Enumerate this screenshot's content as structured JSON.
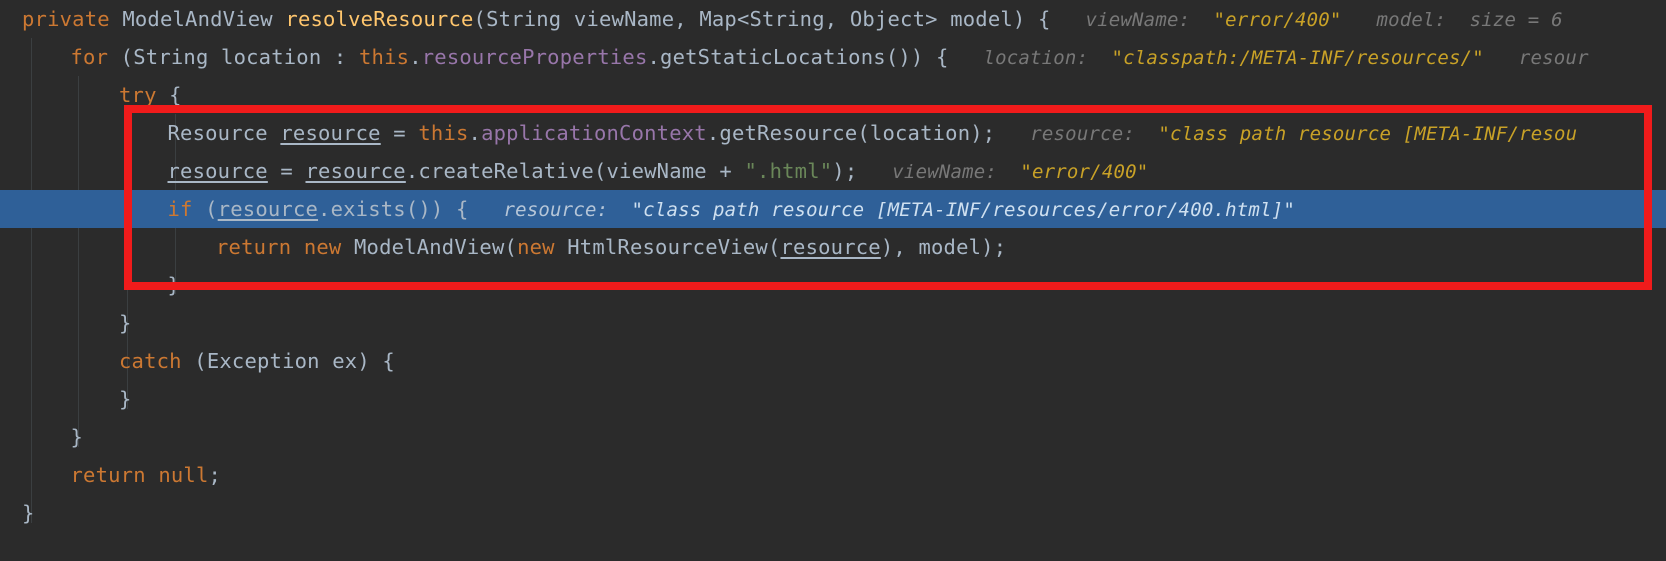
{
  "editor": {
    "language": "Java",
    "theme": "Darcula",
    "background_color": "#2b2b2b",
    "selected_line_color": "#2f6098",
    "annotation_color": "#f01b1b",
    "selected_line_number": 6
  },
  "annotation": {
    "shape": "rectangle",
    "color": "#f01b1b",
    "covers_lines": "Resource resource = ... through closing brace after return"
  },
  "lines": [
    {
      "id": "line-1",
      "indent": 0,
      "tokens": [
        {
          "t": "private",
          "c": "kw"
        },
        {
          "t": " ",
          "c": "plain"
        },
        {
          "t": "ModelAndView",
          "c": "type"
        },
        {
          "t": " ",
          "c": "plain"
        },
        {
          "t": "resolveResource",
          "c": "declfn"
        },
        {
          "t": "(",
          "c": "punct"
        },
        {
          "t": "String",
          "c": "type"
        },
        {
          "t": " viewName, ",
          "c": "plain"
        },
        {
          "t": "Map",
          "c": "type"
        },
        {
          "t": "<",
          "c": "punct"
        },
        {
          "t": "String",
          "c": "type"
        },
        {
          "t": ", ",
          "c": "plain"
        },
        {
          "t": "Object",
          "c": "type"
        },
        {
          "t": "> model) {",
          "c": "plain"
        }
      ],
      "hints": [
        {
          "name": "viewName:",
          "value": "\"error/400\"",
          "kind": "string"
        },
        {
          "name": "model:",
          "value": "size = 6",
          "kind": "plain"
        }
      ]
    },
    {
      "id": "line-2",
      "indent": 1,
      "tokens": [
        {
          "t": "for",
          "c": "kw"
        },
        {
          "t": " (",
          "c": "punct"
        },
        {
          "t": "String",
          "c": "type"
        },
        {
          "t": " location : ",
          "c": "plain"
        },
        {
          "t": "this",
          "c": "kw"
        },
        {
          "t": ".",
          "c": "punct"
        },
        {
          "t": "resourceProperties",
          "c": "field"
        },
        {
          "t": ".",
          "c": "punct"
        },
        {
          "t": "getStaticLocations",
          "c": "method"
        },
        {
          "t": "()) {",
          "c": "punct"
        }
      ],
      "hints": [
        {
          "name": "location:",
          "value": "\"classpath:/META-INF/resources/\"",
          "kind": "string"
        },
        {
          "name": "resour",
          "value": "",
          "kind": "truncated"
        }
      ]
    },
    {
      "id": "line-3",
      "indent": 2,
      "tokens": [
        {
          "t": "try",
          "c": "kw"
        },
        {
          "t": " {",
          "c": "punct"
        }
      ],
      "hints": []
    },
    {
      "id": "line-4",
      "indent": 3,
      "tokens": [
        {
          "t": "Resource",
          "c": "type"
        },
        {
          "t": " ",
          "c": "plain"
        },
        {
          "t": "resource",
          "c": "localvar"
        },
        {
          "t": " = ",
          "c": "plain"
        },
        {
          "t": "this",
          "c": "kw"
        },
        {
          "t": ".",
          "c": "punct"
        },
        {
          "t": "applicationContext",
          "c": "field"
        },
        {
          "t": ".",
          "c": "punct"
        },
        {
          "t": "getResource",
          "c": "method"
        },
        {
          "t": "(location);",
          "c": "punct"
        }
      ],
      "hints": [
        {
          "name": "resource:",
          "value": "\"class path resource [META-INF/resou",
          "kind": "string"
        }
      ]
    },
    {
      "id": "line-5",
      "indent": 3,
      "tokens": [
        {
          "t": "resource",
          "c": "localvar"
        },
        {
          "t": " = ",
          "c": "plain"
        },
        {
          "t": "resource",
          "c": "localvar"
        },
        {
          "t": ".",
          "c": "punct"
        },
        {
          "t": "createRelative",
          "c": "method"
        },
        {
          "t": "(viewName + ",
          "c": "punct"
        },
        {
          "t": "\".html\"",
          "c": "str"
        },
        {
          "t": ");",
          "c": "punct"
        }
      ],
      "hints": [
        {
          "name": "viewName:",
          "value": "\"error/400\"",
          "kind": "string"
        }
      ]
    },
    {
      "id": "line-6",
      "indent": 3,
      "selected": true,
      "tokens": [
        {
          "t": "if",
          "c": "kw"
        },
        {
          "t": " (",
          "c": "punct"
        },
        {
          "t": "resource",
          "c": "localvar"
        },
        {
          "t": ".",
          "c": "punct"
        },
        {
          "t": "exists",
          "c": "method"
        },
        {
          "t": "()) {",
          "c": "punct"
        }
      ],
      "hints": [
        {
          "name": "resource:",
          "value": "\"class path resource [META-INF/resources/error/400.html]\"",
          "kind": "string"
        }
      ]
    },
    {
      "id": "line-7",
      "indent": 4,
      "tokens": [
        {
          "t": "return",
          "c": "kw"
        },
        {
          "t": " ",
          "c": "plain"
        },
        {
          "t": "new",
          "c": "kw"
        },
        {
          "t": " ",
          "c": "plain"
        },
        {
          "t": "ModelAndView",
          "c": "type"
        },
        {
          "t": "(",
          "c": "punct"
        },
        {
          "t": "new",
          "c": "kw"
        },
        {
          "t": " ",
          "c": "plain"
        },
        {
          "t": "HtmlResourceView",
          "c": "type"
        },
        {
          "t": "(",
          "c": "punct"
        },
        {
          "t": "resource",
          "c": "localvar"
        },
        {
          "t": "), model);",
          "c": "punct"
        }
      ],
      "hints": []
    },
    {
      "id": "line-8",
      "indent": 3,
      "tokens": [
        {
          "t": "}",
          "c": "punct"
        }
      ],
      "hints": []
    },
    {
      "id": "line-9",
      "indent": 2,
      "tokens": [
        {
          "t": "}",
          "c": "punct"
        }
      ],
      "hints": []
    },
    {
      "id": "line-10",
      "indent": 2,
      "tokens": [
        {
          "t": "catch",
          "c": "kw"
        },
        {
          "t": " (",
          "c": "punct"
        },
        {
          "t": "Exception",
          "c": "type"
        },
        {
          "t": " ex) {",
          "c": "plain"
        }
      ],
      "hints": []
    },
    {
      "id": "line-11",
      "indent": 2,
      "tokens": [
        {
          "t": "}",
          "c": "punct"
        }
      ],
      "hints": []
    },
    {
      "id": "line-12",
      "indent": 1,
      "tokens": [
        {
          "t": "}",
          "c": "punct"
        }
      ],
      "hints": []
    },
    {
      "id": "line-13",
      "indent": 1,
      "tokens": [
        {
          "t": "return",
          "c": "kw"
        },
        {
          "t": " ",
          "c": "plain"
        },
        {
          "t": "null",
          "c": "kw"
        },
        {
          "t": ";",
          "c": "punct"
        }
      ],
      "hints": []
    },
    {
      "id": "line-14",
      "indent": 0,
      "tokens": [
        {
          "t": "}",
          "c": "punct"
        }
      ],
      "hints": []
    }
  ]
}
